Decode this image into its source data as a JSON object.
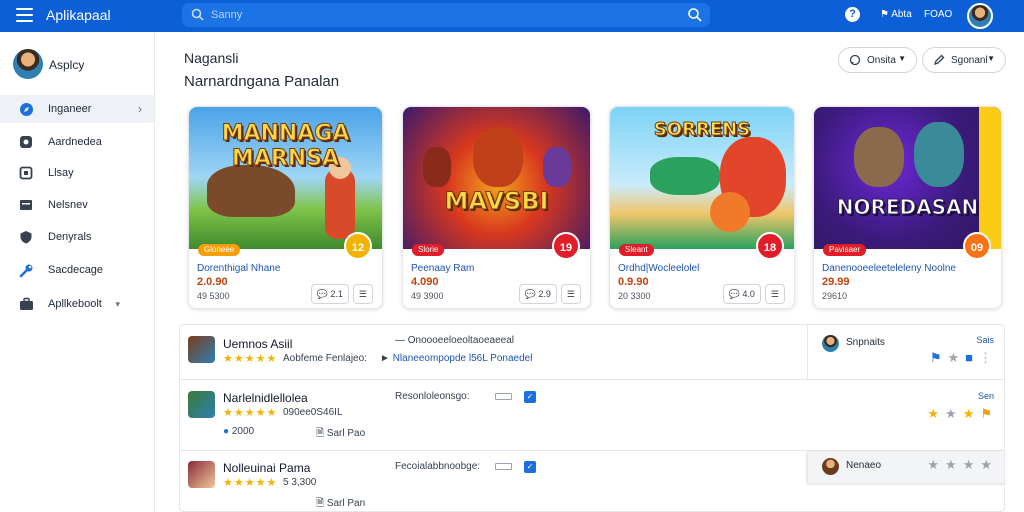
{
  "header": {
    "app_title": "Aplikapaal",
    "search_placeholder": "Sanny",
    "user_label": "Abta",
    "code_label": "FOAO"
  },
  "sidebar": {
    "user_name": "Asplcy",
    "items": [
      {
        "label": "Inganeer",
        "icon": "compass-icon"
      },
      {
        "label": "Aardnedea",
        "icon": "chat-icon"
      },
      {
        "label": "Llsay",
        "icon": "library-icon"
      },
      {
        "label": "Nelsnev",
        "icon": "news-icon"
      },
      {
        "label": "Denyrals",
        "icon": "shield-icon"
      },
      {
        "label": "Sacdecage",
        "icon": "wrench-icon"
      },
      {
        "label": "Apllkeboolt",
        "icon": "briefcase-icon"
      }
    ]
  },
  "main": {
    "heading": "Nagansli",
    "subheading": "Narnardngana Panalan",
    "filters": [
      {
        "label": "Onsita",
        "icon": "chat-icon"
      },
      {
        "label": "Sgonanl",
        "icon": "pen-icon"
      }
    ]
  },
  "cards": [
    {
      "art_title": "MANNAGA MARNSA",
      "badge": "Gloneee",
      "badge_color": "#f59e0b",
      "rating": "12",
      "rating_color": "#f5b301",
      "title": "Dorenthigal Nhane",
      "price": "2.0.90",
      "meta": "49 5300",
      "action1": "2.1",
      "colors": [
        "#4aa3e8",
        "#7fc44a",
        "#3f8a2c"
      ]
    },
    {
      "art_title": "MAVSBI",
      "badge": "Slorie",
      "badge_color": "#e11d2a",
      "rating": "19",
      "rating_color": "#e11d2a",
      "title": "Peenaay Ram",
      "price": "4.090",
      "meta": "49 3900",
      "action1": "2.9",
      "colors": [
        "#f0a21b",
        "#d9381e",
        "#3a1a6b"
      ]
    },
    {
      "art_title": "SORRENS",
      "badge": "Sleant",
      "badge_color": "#e11d2a",
      "rating": "18",
      "rating_color": "#e11d2a",
      "title": "Ordhd|Wocleelolel",
      "price": "0.9.90",
      "meta": "20 3300",
      "action1": "4.0",
      "colors": [
        "#7dd3f5",
        "#f0c66b",
        "#2aa15d"
      ]
    },
    {
      "art_title": "NOREDASAN",
      "badge": "Pavisaer",
      "badge_color": "#e11d2a",
      "rating": "09",
      "rating_color": "#f97316",
      "title": "Danenooeeleeteleleny Noolne",
      "price": "29.99",
      "meta": "29610",
      "action1": "",
      "colors": [
        "#2b1a5e",
        "#6d28d9",
        "#facc15"
      ]
    }
  ],
  "list": [
    {
      "title": "Uemnos Asiil",
      "stars": "★★★★★",
      "sub": "Aobfeme Fenlajeo:",
      "desc": "Onoooeeloeoltaoeaeeal",
      "desc_link": "Nlaneeompopde l56L Ponaedel",
      "meta": "",
      "panel_name": "Snpnaits",
      "panel_link": "Sais"
    },
    {
      "title": "Narlelnidlellolea",
      "stars": "★★★★★",
      "sub": "090ee0S46IL",
      "desc": "Resonloleonsgo:",
      "desc_link": "",
      "meta": "2000",
      "meta2": "Sarl Pao",
      "panel_name": "",
      "panel_link": "Sen"
    },
    {
      "title": "Nolleuinai Pama",
      "stars": "★★★★★",
      "sub": "5 3,300",
      "desc": "Fecoialabbnoobge:",
      "desc_link": "",
      "meta": "",
      "meta2": "Sarl Pan",
      "panel_name": "Nenaeo",
      "panel_link": ""
    }
  ],
  "colors": {
    "brand": "#0d5fd8",
    "accent": "#1e55b3",
    "price": "#c2410c",
    "star": "#f5b301"
  }
}
